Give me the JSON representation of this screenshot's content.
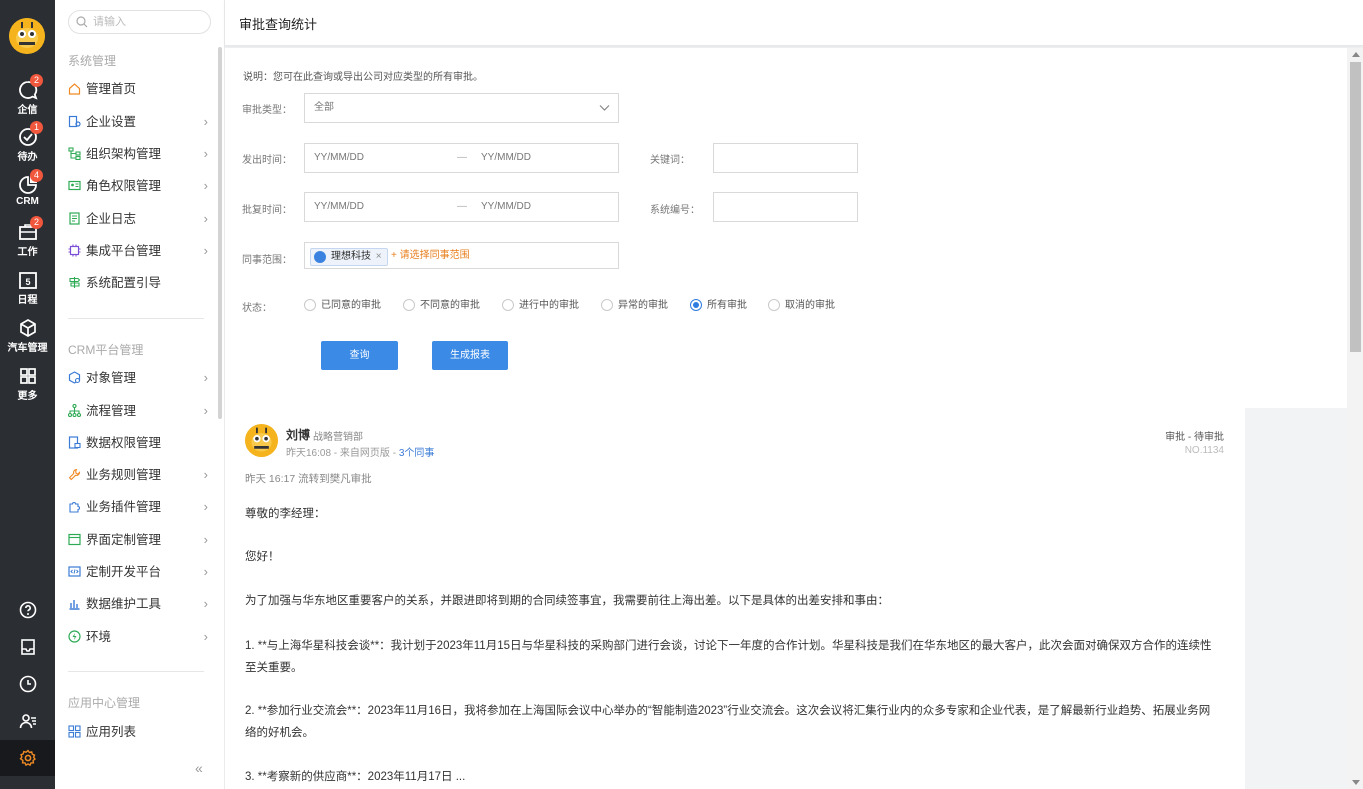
{
  "rail": {
    "items": [
      {
        "label": "企信",
        "badge": "2"
      },
      {
        "label": "待办",
        "badge": "1"
      },
      {
        "label": "CRM",
        "badge": "4"
      },
      {
        "label": "工作",
        "badge": "2"
      },
      {
        "label": "日程",
        "calendar_day": "5"
      },
      {
        "label": "汽车管理"
      },
      {
        "label": "更多"
      }
    ]
  },
  "sidebar": {
    "search_placeholder": "请输入",
    "groups": [
      {
        "title": "系统管理",
        "items": [
          "管理首页",
          "企业设置",
          "组织架构管理",
          "角色权限管理",
          "企业日志",
          "集成平台管理",
          "系统配置引导"
        ]
      },
      {
        "title": "CRM平台管理",
        "items": [
          "对象管理",
          "流程管理",
          "数据权限管理",
          "业务规则管理",
          "业务插件管理",
          "界面定制管理",
          "定制开发平台",
          "数据维护工具",
          "环境"
        ]
      },
      {
        "title": "应用中心管理",
        "items": [
          "应用列表"
        ]
      }
    ],
    "collapse_label": "«"
  },
  "header": {
    "title": "审批查询统计"
  },
  "form": {
    "note": "说明：您可在此查询或导出公司对应类型的所有审批。",
    "type_label": "审批类型：",
    "type_value": "全部",
    "send_time_label": "发出时间：",
    "reply_time_label": "批复时间：",
    "date_placeholder": "YY/MM/DD",
    "date_sep": "—",
    "keyword_label": "关键词：",
    "sysno_label": "系统编号：",
    "colleague_label": "同事范围：",
    "colleague_tag": "理想科技",
    "colleague_tag_close": "×",
    "colleague_add": "+ 请选择同事范围",
    "status_label": "状态：",
    "statuses": [
      "已同意的审批",
      "不同意的审批",
      "进行中的审批",
      "异常的审批",
      "所有审批",
      "取消的审批"
    ],
    "status_selected": "所有审批",
    "query_button": "查询",
    "report_button": "生成报表"
  },
  "card": {
    "name": "刘博",
    "dept": "战略营销部",
    "meta_prefix": "昨天16:08 - 来自网页版 - ",
    "meta_link": "3个同事",
    "status": "审批 - 待审批",
    "no": "NO.1134",
    "flow": "昨天 16:17 流转到樊凡审批",
    "paragraphs": [
      "尊敬的李经理：",
      "您好！",
      "为了加强与华东地区重要客户的关系，并跟进即将到期的合同续签事宜，我需要前往上海出差。以下是具体的出差安排和事由：",
      "1. **与上海华星科技会谈**：我计划于2023年11月15日与华星科技的采购部门进行会谈，讨论下一年度的合作计划。华星科技是我们在华东地区的最大客户，此次会面对确保双方合作的连续性至关重要。",
      "2. **参加行业交流会**：2023年11月16日，我将参加在上海国际会议中心举办的“智能制造2023”行业交流会。这次会议将汇集行业内的众多专家和企业代表，是了解最新行业趋势、拓展业务网络的好机会。",
      "3. **考察新的供应商**：2023年11月17日 ..."
    ]
  }
}
